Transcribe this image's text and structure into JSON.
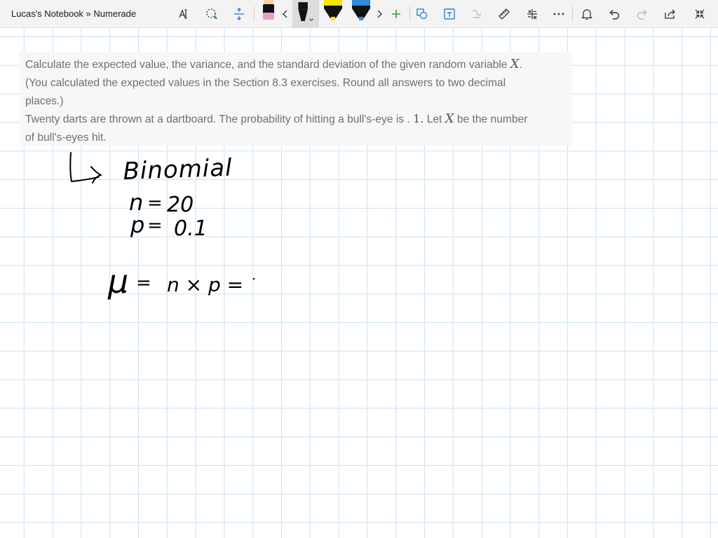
{
  "window": {
    "title": "Lucas's Notebook » Numerade"
  },
  "toolbar": {
    "tools": [
      "text-select-icon",
      "lasso-select-icon",
      "insert-space-icon",
      "pen-pink-icon",
      "scroll-left-icon",
      "pen-black-icon",
      "highlighter-yellow-icon",
      "highlighter-blue-icon",
      "scroll-right-icon",
      "add-pen-icon",
      "ink-to-shape-icon",
      "ink-to-text-icon",
      "ink-to-math-icon",
      "ruler-icon",
      "math-icon",
      "more-icon",
      "notifications-icon",
      "undo-icon",
      "redo-icon",
      "share-icon",
      "fullscreen-icon"
    ],
    "colors": {
      "pen_pink": "#e8a0c8",
      "pen_black": "#111111",
      "highlighter_yellow": "#f5e400",
      "highlighter_blue": "#2f8ad8",
      "add_green": "#2e9e3e"
    }
  },
  "question": {
    "line1_text": "Calculate the expected value, the variance, and the standard deviation of the given random variable ",
    "line1_var": "X",
    "line1_end": ".",
    "line2": "(You calculated the expected values in the Section 8.3 exercises. Round all answers to two decimal",
    "line3": "places.)",
    "line4_text": "Twenty darts are thrown at a dartboard. The probability of hitting a bull's-eye is . ",
    "line4_num": "1.",
    "line4_mid": " Let ",
    "line4_var": "X",
    "line4_end": " be the number",
    "line5": "of bull's-eyes hit."
  },
  "ink": {
    "word_binomial": "Binomial",
    "n_label": "n",
    "n_value": "20",
    "p_label": "p",
    "p_value": "0.1",
    "mu_symbol": "μ",
    "formula": "n × p ="
  },
  "colors": {
    "grid": "#c9e2f3",
    "ink": "#000000",
    "question_bg": "#f6f7f9",
    "question_text": "#6f6f6f"
  }
}
